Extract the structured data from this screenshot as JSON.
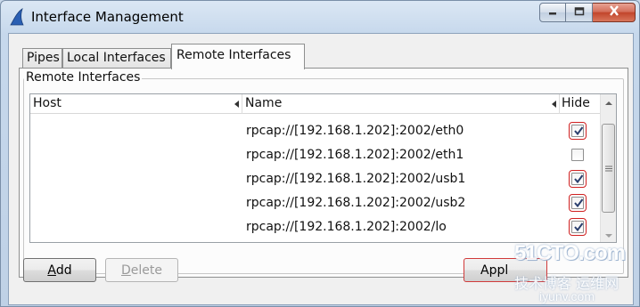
{
  "window": {
    "title": "Interface Management",
    "icon": "shark-fin-icon"
  },
  "tabs": [
    {
      "label": "Pipes",
      "active": false
    },
    {
      "label": "Local Interfaces",
      "active": false
    },
    {
      "label": "Remote Interfaces",
      "active": true
    }
  ],
  "group": {
    "title": "Remote Interfaces"
  },
  "table": {
    "columns": {
      "host": "Host",
      "name": "Name",
      "hide": "Hide"
    },
    "rows": [
      {
        "host": "",
        "name": "rpcap://[192.168.1.202]:2002/eth0",
        "hide": true
      },
      {
        "host": "",
        "name": "rpcap://[192.168.1.202]:2002/eth1",
        "hide": false
      },
      {
        "host": "",
        "name": "rpcap://[192.168.1.202]:2002/usb1",
        "hide": true
      },
      {
        "host": "",
        "name": "rpcap://[192.168.1.202]:2002/usb2",
        "hide": true
      },
      {
        "host": "",
        "name": "rpcap://[192.168.1.202]:2002/lo",
        "hide": true
      }
    ]
  },
  "buttons": {
    "add_prefix": "",
    "add_mnemonic": "A",
    "add_rest": "dd",
    "delete_prefix": "",
    "delete_mnemonic": "D",
    "delete_rest": "elete",
    "apply_label": "Appl"
  },
  "watermark": {
    "line1": "51CTO.com",
    "line2": "技术博客 运维网",
    "line3": "iyunv.com"
  },
  "colors": {
    "highlight": "#d02020",
    "titlebar": "#c6d8ec"
  }
}
